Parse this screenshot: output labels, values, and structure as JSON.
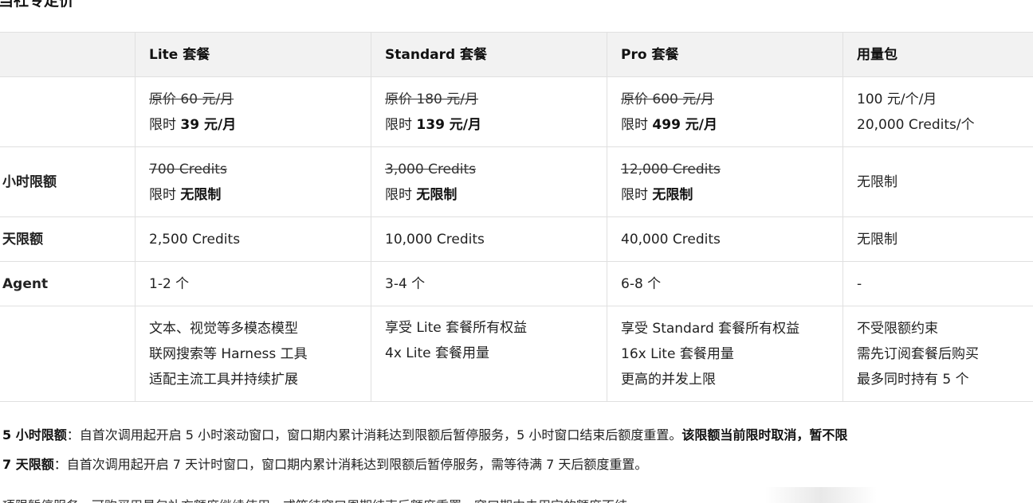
{
  "heading": "当社专定价",
  "table": {
    "headers": [
      "",
      "Lite 套餐",
      "Standard 套餐",
      "Pro 套餐",
      "用量包"
    ],
    "price_row": {
      "label": "",
      "lite": {
        "orig": "原价 60 元/月",
        "prefix": "限时 ",
        "sale": "39 元/月"
      },
      "standard": {
        "orig": "原价 180 元/月",
        "prefix": "限时 ",
        "sale": "139 元/月"
      },
      "pro": {
        "orig": "原价 600 元/月",
        "prefix": "限时 ",
        "sale": "499 元/月"
      },
      "pack": {
        "line1": "100 元/个/月",
        "line2": "20,000 Credits/个"
      }
    },
    "five_hour_row": {
      "label": "小时限额",
      "lite": {
        "orig": "700 Credits",
        "prefix": "限时 ",
        "sale": "无限制"
      },
      "standard": {
        "orig": "3,000 Credits",
        "prefix": "限时 ",
        "sale": "无限制"
      },
      "pro": {
        "orig": "12,000 Credits",
        "prefix": "限时 ",
        "sale": "无限制"
      },
      "pack": "无限制"
    },
    "seven_day_row": {
      "label": "天限额",
      "lite": "2,500 Credits",
      "standard": "10,000 Credits",
      "pro": "40,000 Credits",
      "pack": "无限制"
    },
    "agent_row": {
      "label": "Agent",
      "lite": "1-2 个",
      "standard": "3-4 个",
      "pro": "6-8 个",
      "pack": "-"
    },
    "features_row": {
      "label": "",
      "lite": [
        "文本、视觉等多模态模型",
        "联网搜索等 Harness 工具",
        "适配主流工具并持续扩展"
      ],
      "standard": [
        "享受 Lite 套餐所有权益",
        "4x Lite 套餐用量"
      ],
      "pro": [
        "享受 Standard 套餐所有权益",
        "16x Lite 套餐用量",
        "更高的并发上限"
      ],
      "pack": [
        "不受限额约束",
        "需先订阅套餐后购买",
        "最多同时持有 5 个"
      ]
    }
  },
  "notes": {
    "n1_bold": "5 小时限额",
    "n1_text": "：自首次调用起开启 5 小时滚动窗口，窗口期内累计消耗达到限额后暂停服务，5 小时窗口结束后额度重置。",
    "n1_tail": "该限额当前限时取消，暂不限",
    "n2_bold": "7 天限额",
    "n2_text": "：自首次调用起开启 7 天计时窗口，窗口期内累计消耗达到限额后暂停服务，需等待满 7 天后额度重置。",
    "n3_text": "项限暂停服务，可购买用量包补充额度继续使用，或等待窗口周期结束后额度重置。窗口期内未用完的额度不结"
  }
}
